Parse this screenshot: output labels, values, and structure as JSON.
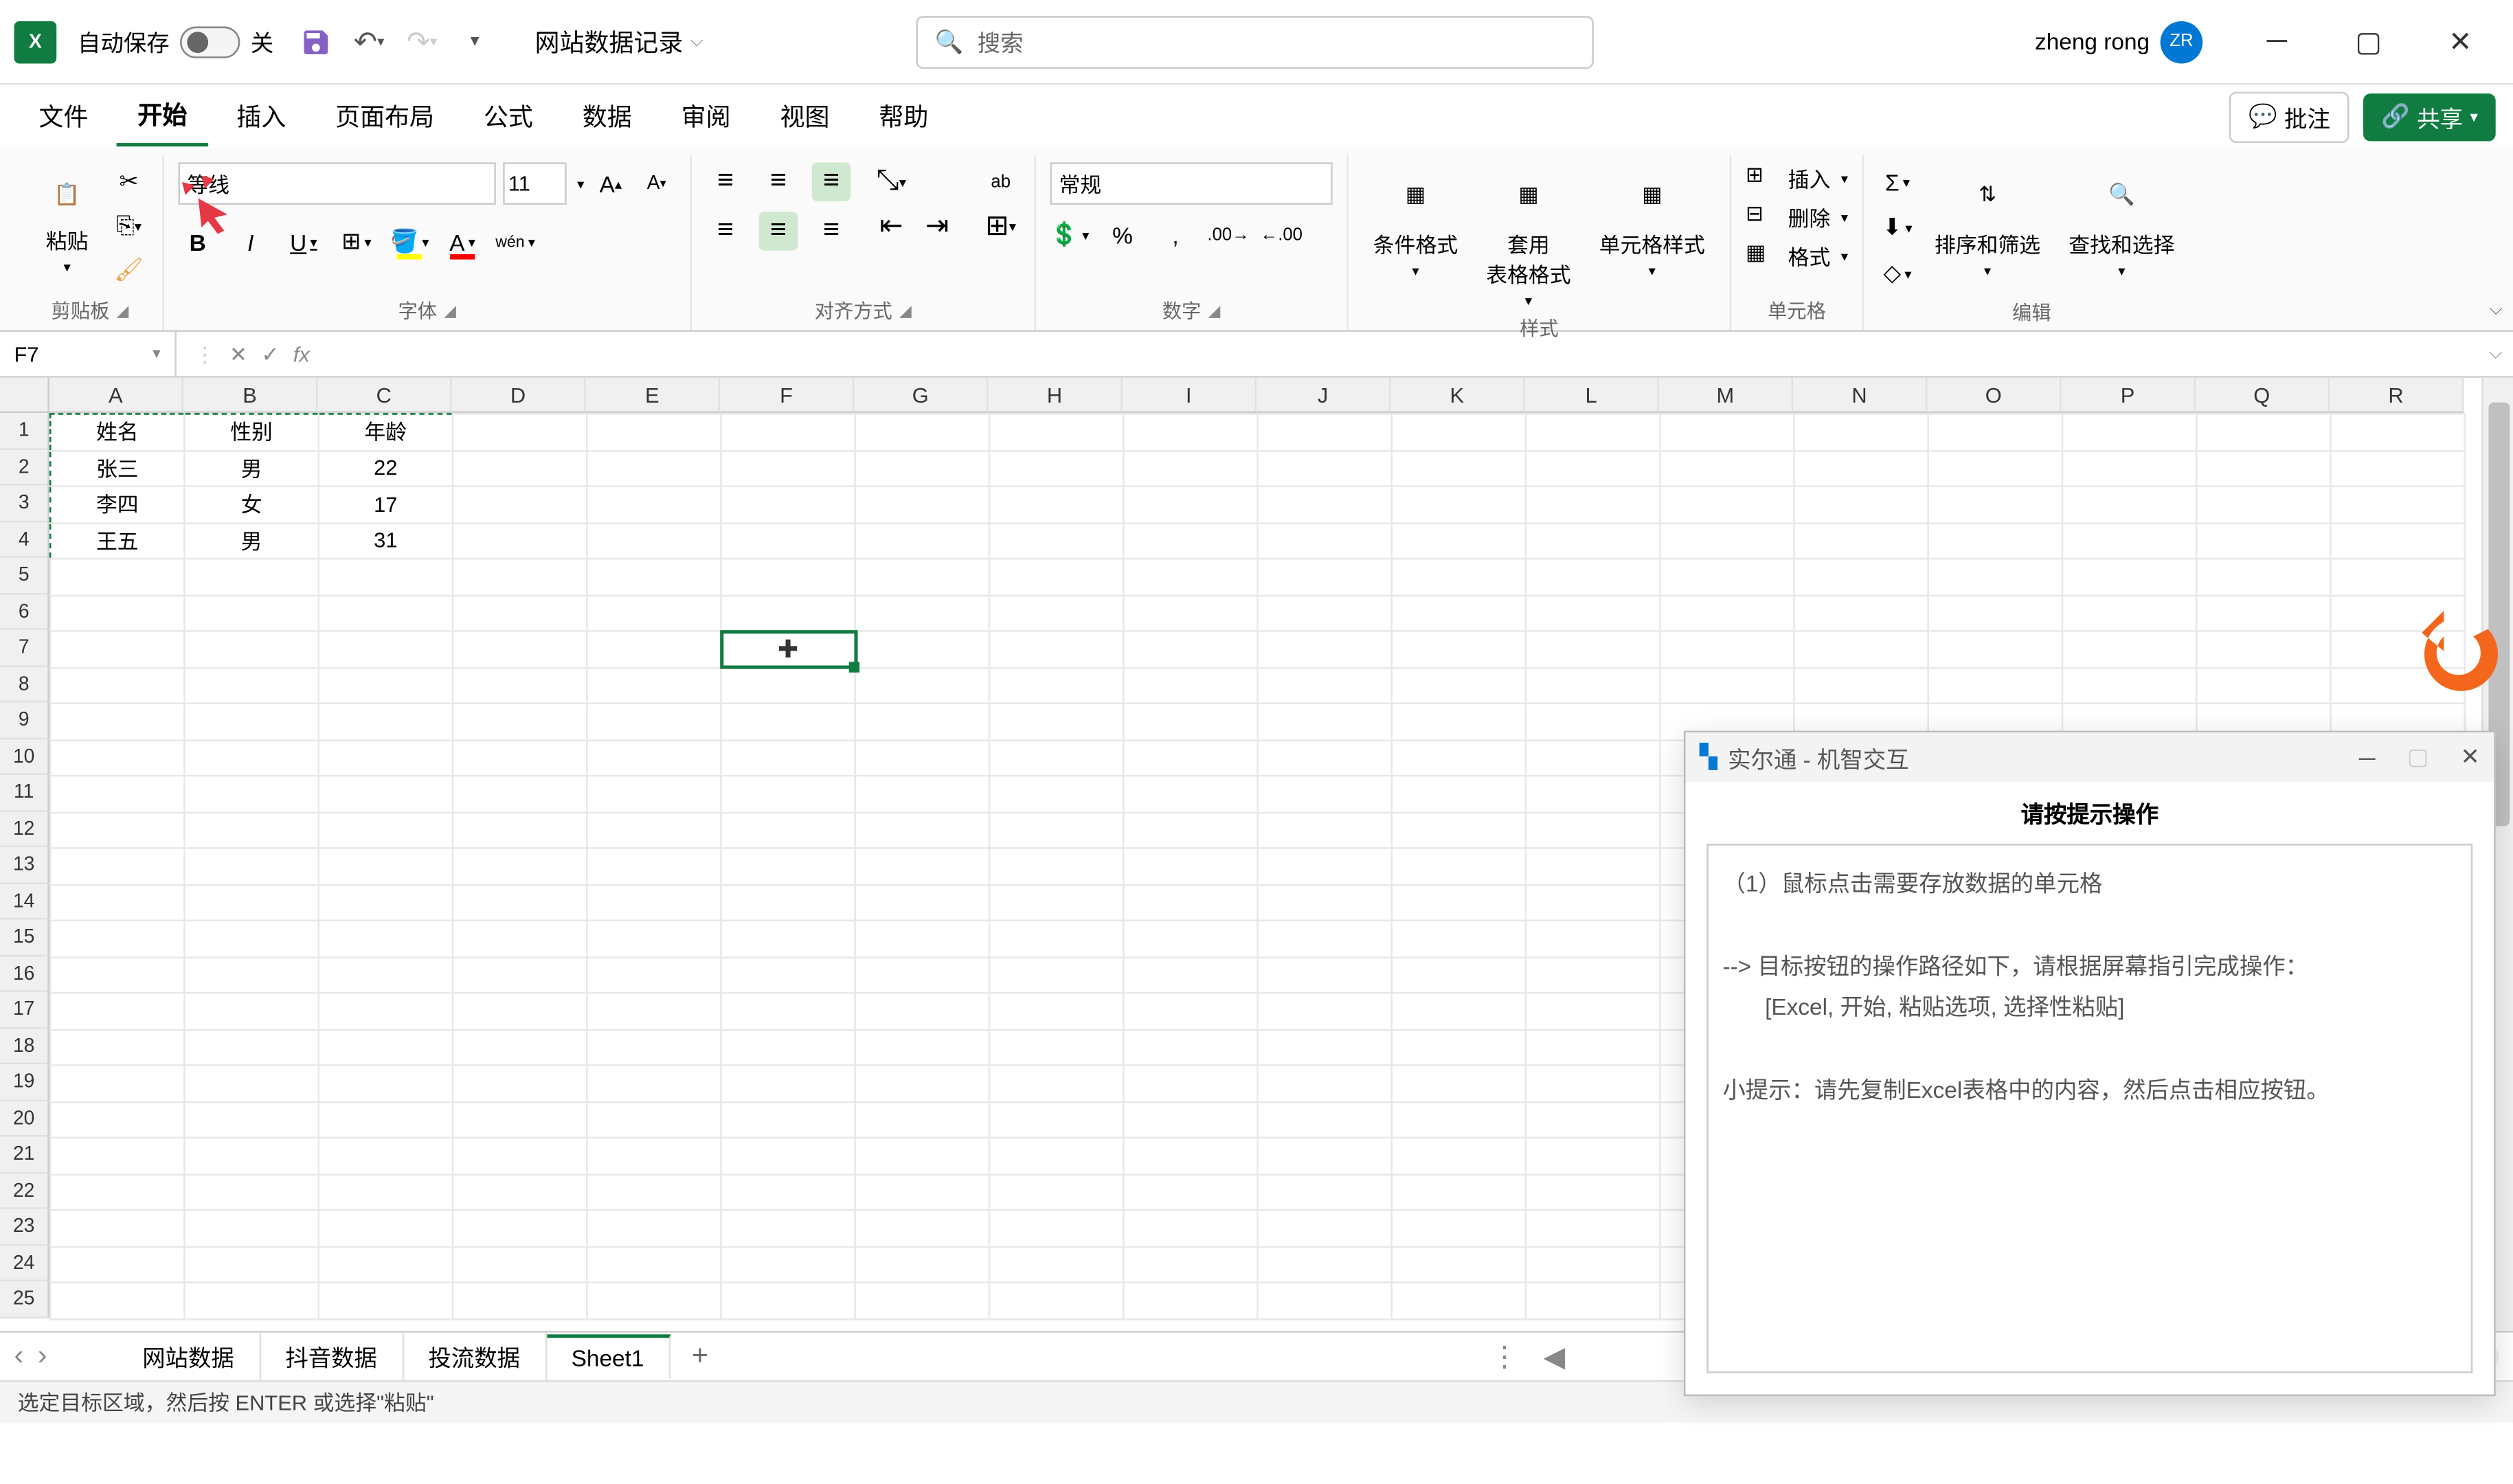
{
  "titlebar": {
    "logo": "X",
    "autosave_label": "自动保存",
    "autosave_state": "关",
    "doc_name": "网站数据记录",
    "search_placeholder": "搜索",
    "user_name": "zheng rong",
    "user_initials": "ZR"
  },
  "ribbon_tabs": {
    "items": [
      "文件",
      "开始",
      "插入",
      "页面布局",
      "公式",
      "数据",
      "审阅",
      "视图",
      "帮助"
    ],
    "active_index": 1,
    "comments": "批注",
    "share": "共享"
  },
  "ribbon": {
    "clipboard": {
      "paste": "粘贴",
      "label": "剪贴板"
    },
    "font": {
      "name": "等线",
      "size": "11",
      "label": "字体",
      "bold": "B",
      "italic": "I",
      "underline": "U",
      "phonetic": "wén"
    },
    "alignment": {
      "label": "对齐方式",
      "wrap": "ab"
    },
    "number": {
      "format": "常规",
      "label": "数字"
    },
    "styles": {
      "conditional": "条件格式",
      "table": "套用\n表格格式",
      "cell": "单元格样式",
      "label": "样式"
    },
    "cells": {
      "insert": "插入",
      "delete": "删除",
      "format": "格式",
      "label": "单元格"
    },
    "editing": {
      "sort": "排序和筛选",
      "find": "查找和选择",
      "label": "编辑"
    }
  },
  "formula_bar": {
    "name_box": "F7",
    "fx": "fx"
  },
  "grid": {
    "columns": [
      "A",
      "B",
      "C",
      "D",
      "E",
      "F",
      "G",
      "H",
      "I",
      "J",
      "K",
      "L",
      "M",
      "N",
      "O",
      "P",
      "Q",
      "R"
    ],
    "row_count": 25,
    "data": [
      {
        "A": "姓名",
        "B": "性别",
        "C": "年龄"
      },
      {
        "A": "张三",
        "B": "男",
        "C": "22"
      },
      {
        "A": "李四",
        "B": "女",
        "C": "17"
      },
      {
        "A": "王五",
        "B": "男",
        "C": "31"
      }
    ],
    "selected_cell": "F7"
  },
  "sheets": {
    "items": [
      "网站数据",
      "抖音数据",
      "投流数据",
      "Sheet1"
    ],
    "active_index": 3
  },
  "status_bar": {
    "text": "选定目标区域，然后按 ENTER 或选择\"粘贴\""
  },
  "dialog": {
    "title": "实尔通 - 机智交互",
    "header": "请按提示操作",
    "line1": "（1）鼠标点击需要存放数据的单元格",
    "line2": "--> 目标按钮的操作路径如下，请根据屏幕指引完成操作：",
    "line3": "[Excel, 开始, 粘贴选项, 选择性粘贴]",
    "line4": "小提示：请先复制Excel表格中的内容，然后点击相应按钮。"
  }
}
